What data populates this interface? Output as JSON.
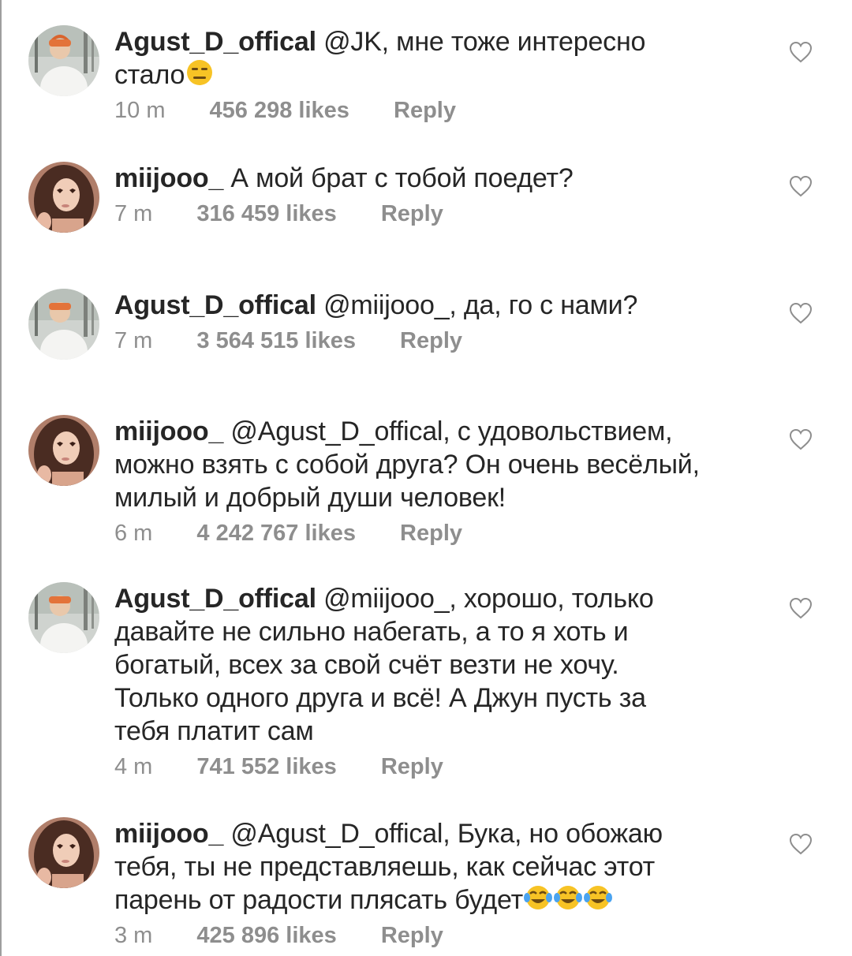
{
  "comments": [
    {
      "username": "Agust_D_offical",
      "text": " @JK, мне тоже интересно стало",
      "emoji": "expressionless-face",
      "time": "10 m",
      "likes": "456 298 likes",
      "reply": "Reply"
    },
    {
      "username": "miijooo_",
      "text": " А мой брат с тобой поедет?",
      "time": "7 m",
      "likes": "316 459 likes",
      "reply": "Reply"
    },
    {
      "username": "Agust_D_offical",
      "text": " @miijooo_, да, го с нами?",
      "time": "7 m",
      "likes": "3 564 515 likes",
      "reply": "Reply"
    },
    {
      "username": "miijooo_",
      "text": " @Agust_D_offical, с удовольствием, можно взять с собой друга? Он очень весёлый, милый и добрый души человек!",
      "time": "6 m",
      "likes": "4 242 767 likes",
      "reply": "Reply"
    },
    {
      "username": "Agust_D_offical",
      "text": " @miijooo_, хорошо, только давайте не сильно набегать, а то я хоть и богатый, всех за свой счёт везти не хочу. Только одного друга и всё! А Джун пусть за тебя платит сам",
      "time": "4 m",
      "likes": "741 552 likes",
      "reply": "Reply"
    },
    {
      "username": "miijooo_",
      "text": " @Agust_D_offical, Бука, но обожаю тебя, ты не представляешь, как сейчас этот парень от радости плясать будет",
      "emoji": "face-with-tears-of-joy x3",
      "time": "3 m",
      "likes": "425 896 likes",
      "reply": "Reply"
    }
  ],
  "colors": {
    "text": "#262626",
    "meta": "#8e8e8e",
    "heart_outline": "#8e8e8e",
    "emoji_yellow": "#f7c325",
    "tear_blue": "#4aa3f0"
  },
  "icons": {
    "like": "heart-outline-icon"
  }
}
